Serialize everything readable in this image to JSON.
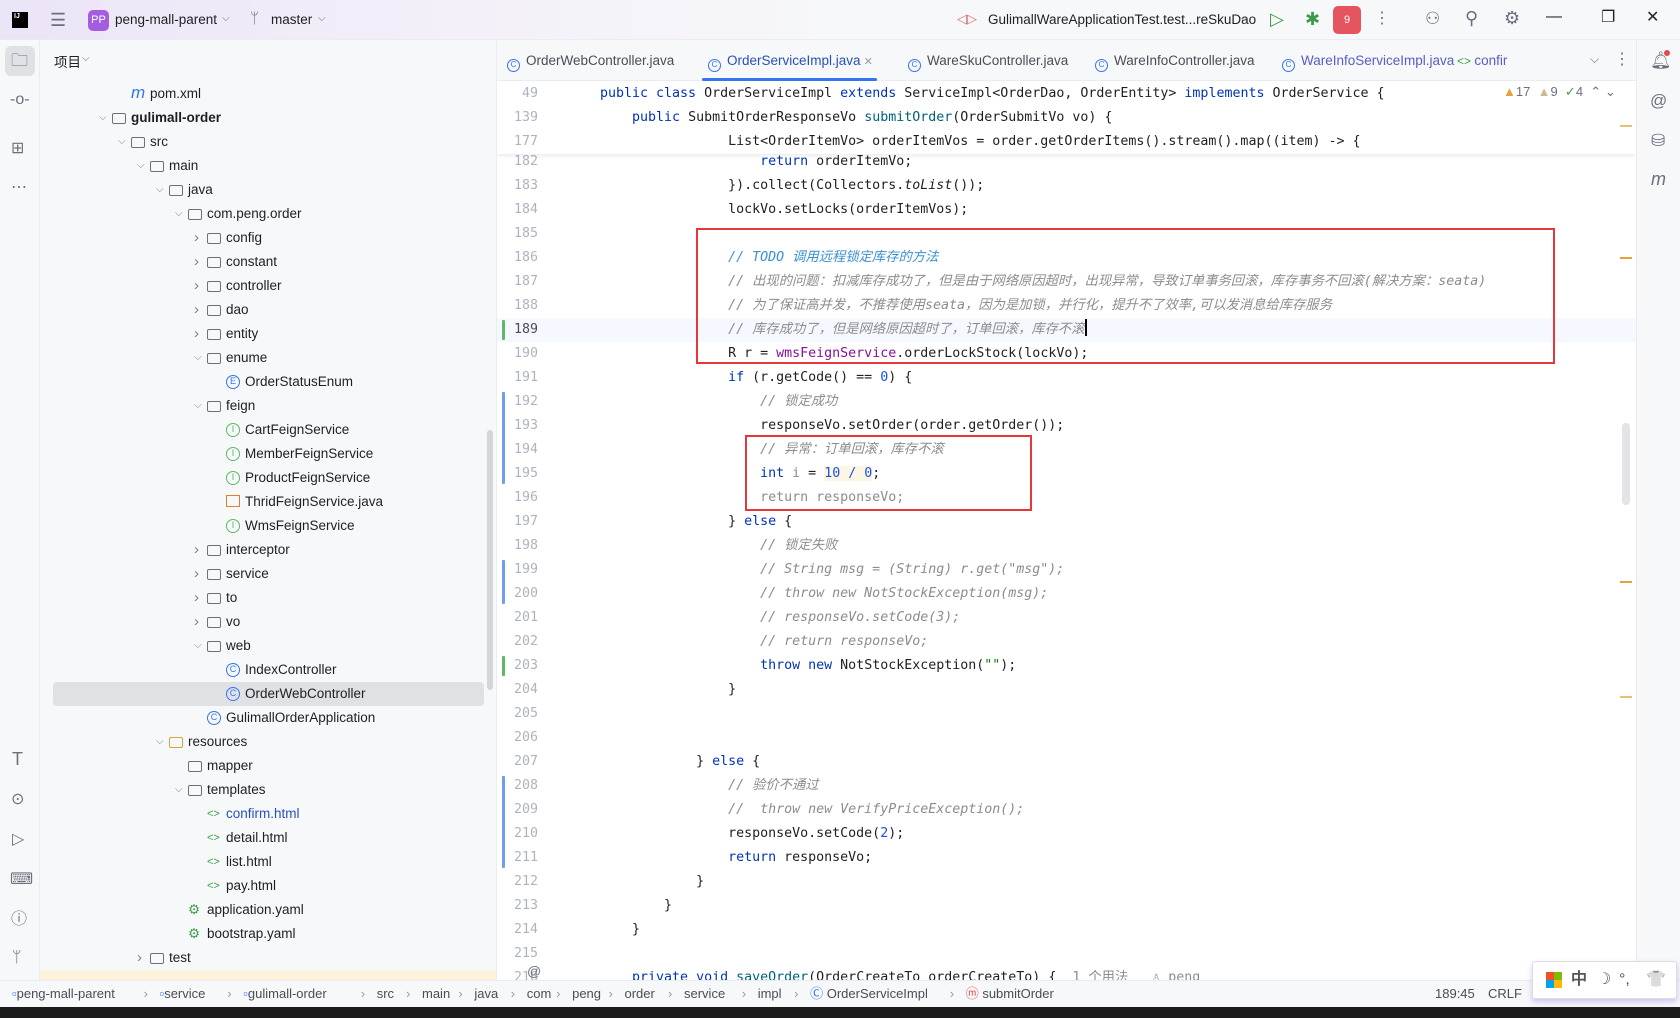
{
  "titlebar": {
    "project_badge": "PP",
    "project_name": "peng-mall-parent",
    "branch": "master",
    "run_config": "GulimallWareApplicationTest.test...reSkuDao",
    "badge_count": "9"
  },
  "project_panel": {
    "title": "项目"
  },
  "tree": [
    {
      "label": "pom.xml",
      "depth": 1,
      "kind": "maven"
    },
    {
      "label": "gulimall-order",
      "depth": 0,
      "kind": "module",
      "open": true,
      "bold": true
    },
    {
      "label": "src",
      "depth": 1,
      "kind": "folder",
      "open": true
    },
    {
      "label": "main",
      "depth": 2,
      "kind": "folder",
      "open": true
    },
    {
      "label": "java",
      "depth": 3,
      "kind": "folder",
      "open": true
    },
    {
      "label": "com.peng.order",
      "depth": 4,
      "kind": "package",
      "open": true
    },
    {
      "label": "config",
      "depth": 5,
      "kind": "package",
      "open": false
    },
    {
      "label": "constant",
      "depth": 5,
      "kind": "package",
      "open": false
    },
    {
      "label": "controller",
      "depth": 5,
      "kind": "package",
      "open": false
    },
    {
      "label": "dao",
      "depth": 5,
      "kind": "package",
      "open": false
    },
    {
      "label": "entity",
      "depth": 5,
      "kind": "package",
      "open": false
    },
    {
      "label": "enume",
      "depth": 5,
      "kind": "package",
      "open": true
    },
    {
      "label": "OrderStatusEnum",
      "depth": 6,
      "kind": "enum"
    },
    {
      "label": "feign",
      "depth": 5,
      "kind": "package",
      "open": true
    },
    {
      "label": "CartFeignService",
      "depth": 6,
      "kind": "interface"
    },
    {
      "label": "MemberFeignService",
      "depth": 6,
      "kind": "interface"
    },
    {
      "label": "ProductFeignService",
      "depth": 6,
      "kind": "interface"
    },
    {
      "label": "ThridFeignService.java",
      "depth": 6,
      "kind": "javafile"
    },
    {
      "label": "WmsFeignService",
      "depth": 6,
      "kind": "interface"
    },
    {
      "label": "interceptor",
      "depth": 5,
      "kind": "package",
      "open": false
    },
    {
      "label": "service",
      "depth": 5,
      "kind": "package",
      "open": false
    },
    {
      "label": "to",
      "depth": 5,
      "kind": "package",
      "open": false
    },
    {
      "label": "vo",
      "depth": 5,
      "kind": "package",
      "open": false
    },
    {
      "label": "web",
      "depth": 5,
      "kind": "package",
      "open": true
    },
    {
      "label": "IndexController",
      "depth": 6,
      "kind": "class"
    },
    {
      "label": "OrderWebController",
      "depth": 6,
      "kind": "class",
      "selected": true
    },
    {
      "label": "GulimallOrderApplication",
      "depth": 5,
      "kind": "class"
    },
    {
      "label": "resources",
      "depth": 3,
      "kind": "resfolder",
      "open": true
    },
    {
      "label": "mapper",
      "depth": 4,
      "kind": "folder"
    },
    {
      "label": "templates",
      "depth": 4,
      "kind": "folder",
      "open": true
    },
    {
      "label": "confirm.html",
      "depth": 5,
      "kind": "html",
      "color": "#2750b8"
    },
    {
      "label": "detail.html",
      "depth": 5,
      "kind": "html"
    },
    {
      "label": "list.html",
      "depth": 5,
      "kind": "html"
    },
    {
      "label": "pay.html",
      "depth": 5,
      "kind": "html"
    },
    {
      "label": "application.yaml",
      "depth": 4,
      "kind": "yaml"
    },
    {
      "label": "bootstrap.yaml",
      "depth": 4,
      "kind": "yaml"
    },
    {
      "label": "test",
      "depth": 2,
      "kind": "folder",
      "open": false
    }
  ],
  "tabs": [
    {
      "label": "OrderWebController.java",
      "icon": "class"
    },
    {
      "label": "OrderServiceImpl.java",
      "icon": "class",
      "active": true
    },
    {
      "label": "WareSkuController.java",
      "icon": "class"
    },
    {
      "label": "WareInfoController.java",
      "icon": "class"
    },
    {
      "label": "WareInfoServiceImpl.java",
      "icon": "class"
    },
    {
      "label": "confir",
      "icon": "html"
    }
  ],
  "inspections": {
    "warnings": "17",
    "weak_warnings": "9",
    "ok": "4"
  },
  "sticky": [
    {
      "n": "49",
      "seg": [
        [
          "public class ",
          "kw"
        ],
        [
          "OrderServiceImpl ",
          ""
        ],
        [
          "extends ",
          "kw"
        ],
        [
          "ServiceImpl<OrderDao, OrderEntity> ",
          ""
        ],
        [
          "implements ",
          "kw"
        ],
        [
          "OrderService {",
          ""
        ]
      ]
    },
    {
      "n": "139",
      "seg": [
        [
          "    public ",
          "kw"
        ],
        [
          "SubmitOrderResponseVo ",
          ""
        ],
        [
          "submitOrder",
          "mth"
        ],
        [
          "(OrderSubmitVo vo) {",
          ""
        ]
      ]
    },
    {
      "n": "177",
      "seg": [
        [
          "                List<OrderItemVo> orderItemVos = order.getOrderItems().stream().map((item) -> {",
          ""
        ]
      ]
    }
  ],
  "lines": [
    {
      "n": "182",
      "seg": [
        [
          "                    return ",
          "kw"
        ],
        [
          "orderItemVo;",
          ""
        ]
      ]
    },
    {
      "n": "183",
      "seg": [
        [
          "                }).collect(Collectors.",
          ""
        ],
        [
          "toList",
          "it"
        ],
        [
          "());",
          ""
        ]
      ]
    },
    {
      "n": "184",
      "seg": [
        [
          "                lockVo.setLocks(orderItemVos);",
          ""
        ]
      ]
    },
    {
      "n": "185",
      "seg": []
    },
    {
      "n": "186",
      "seg": [
        [
          "                // TODO 调用远程锁定库存的方法",
          "todo"
        ]
      ]
    },
    {
      "n": "187",
      "seg": [
        [
          "                // 出现的问题：扣减库存成功了，但是由于网络原因超时，出现异常，导致订单事务回滚，库存事务不回滚(解决方案：seata)",
          "cm"
        ]
      ]
    },
    {
      "n": "188",
      "seg": [
        [
          "                // 为了保证高并发，不推荐使用seata，因为是加锁，并行化，提升不了效率,可以发消息给库存服务",
          "cm"
        ]
      ]
    },
    {
      "n": "189",
      "current": true,
      "seg": [
        [
          "                // 库存成功了，但是网络原因超时了，订单回滚，库存不滚",
          "cm"
        ]
      ]
    },
    {
      "n": "190",
      "seg": [
        [
          "                R r = ",
          ""
        ],
        [
          "wmsFeignService",
          "fld"
        ],
        [
          ".orderLockStock(lockVo);",
          ""
        ]
      ]
    },
    {
      "n": "191",
      "seg": [
        [
          "                if ",
          "kw"
        ],
        [
          "(r.getCode() == ",
          ""
        ],
        [
          "0",
          "num"
        ],
        [
          ") {",
          ""
        ]
      ]
    },
    {
      "n": "192",
      "seg": [
        [
          "                    // 锁定成功",
          "cm"
        ]
      ]
    },
    {
      "n": "193",
      "seg": [
        [
          "                    responseVo.setOrder(order.getOrder());",
          ""
        ]
      ]
    },
    {
      "n": "194",
      "seg": [
        [
          "                    // 异常：订单回滚，库存不滚",
          "cm"
        ]
      ]
    },
    {
      "n": "195",
      "seg": [
        [
          "                    int ",
          "kw"
        ],
        [
          "i",
          "dim"
        ],
        [
          " = ",
          ""
        ],
        [
          "10 / 0",
          "num hl"
        ],
        [
          ";",
          ""
        ]
      ]
    },
    {
      "n": "196",
      "seg": [
        [
          "                    return responseVo;",
          "dim"
        ]
      ]
    },
    {
      "n": "197",
      "seg": [
        [
          "                } ",
          ""
        ],
        [
          "else ",
          "kw"
        ],
        [
          "{",
          ""
        ]
      ]
    },
    {
      "n": "198",
      "seg": [
        [
          "                    // 锁定失败",
          "cm"
        ]
      ]
    },
    {
      "n": "199",
      "seg": [
        [
          "                    // String msg = (String) r.get(\"msg\");",
          "cm"
        ]
      ]
    },
    {
      "n": "200",
      "seg": [
        [
          "                    // throw new NotStockException(msg);",
          "cm"
        ]
      ]
    },
    {
      "n": "201",
      "seg": [
        [
          "                    // responseVo.setCode(3);",
          "cm"
        ]
      ]
    },
    {
      "n": "202",
      "seg": [
        [
          "                    // return responseVo;",
          "cm"
        ]
      ]
    },
    {
      "n": "203",
      "seg": [
        [
          "                    throw new ",
          "kw"
        ],
        [
          "NotStockException(",
          ""
        ],
        [
          "\"\"",
          "str"
        ],
        [
          ");",
          ""
        ]
      ]
    },
    {
      "n": "204",
      "seg": [
        [
          "                }",
          ""
        ]
      ]
    },
    {
      "n": "205",
      "seg": []
    },
    {
      "n": "206",
      "seg": []
    },
    {
      "n": "207",
      "seg": [
        [
          "            } ",
          ""
        ],
        [
          "else ",
          "kw"
        ],
        [
          "{",
          ""
        ]
      ]
    },
    {
      "n": "208",
      "seg": [
        [
          "                // 验价不通过",
          "cm"
        ]
      ]
    },
    {
      "n": "209",
      "seg": [
        [
          "                //  throw new VerifyPriceException();",
          "cm"
        ]
      ]
    },
    {
      "n": "210",
      "seg": [
        [
          "                responseVo.setCode(",
          ""
        ],
        [
          "2",
          "num"
        ],
        [
          ");",
          ""
        ]
      ]
    },
    {
      "n": "211",
      "seg": [
        [
          "                return ",
          "kw"
        ],
        [
          "responseVo;",
          ""
        ]
      ]
    },
    {
      "n": "212",
      "seg": [
        [
          "            }",
          ""
        ]
      ]
    },
    {
      "n": "213",
      "seg": [
        [
          "        }",
          ""
        ]
      ]
    },
    {
      "n": "214",
      "seg": [
        [
          "    }",
          ""
        ]
      ]
    },
    {
      "n": "215",
      "seg": []
    },
    {
      "n": "216",
      "seg": [
        [
          "    private void ",
          "kw"
        ],
        [
          "saveOrder",
          "mth"
        ],
        [
          "(OrderCreateTo orderCreateTo) {  ",
          ""
        ],
        [
          "1 个用法   ♙ peng",
          "dim"
        ]
      ]
    }
  ],
  "breadcrumb": [
    {
      "label": "peng-mall-parent",
      "icon": "module"
    },
    {
      "label": "service",
      "icon": "module"
    },
    {
      "label": "gulimall-order",
      "icon": "module"
    },
    {
      "label": "src"
    },
    {
      "label": "main"
    },
    {
      "label": "java"
    },
    {
      "label": "com"
    },
    {
      "label": "peng"
    },
    {
      "label": "order"
    },
    {
      "label": "service"
    },
    {
      "label": "impl"
    },
    {
      "label": "OrderServiceImpl",
      "icon": "class"
    },
    {
      "label": "submitOrder",
      "icon": "method"
    }
  ],
  "status": {
    "position": "189:45",
    "line_ending": "CRLF"
  },
  "ime": {
    "mode": "中",
    "moon": "☽",
    "punct": "°,",
    "skin": "👕"
  },
  "colors": {
    "accent": "#3574f0",
    "highlight_box": "#e8373a",
    "vcs_added": "#5fb865",
    "vcs_modified": "#6f9bf0"
  }
}
